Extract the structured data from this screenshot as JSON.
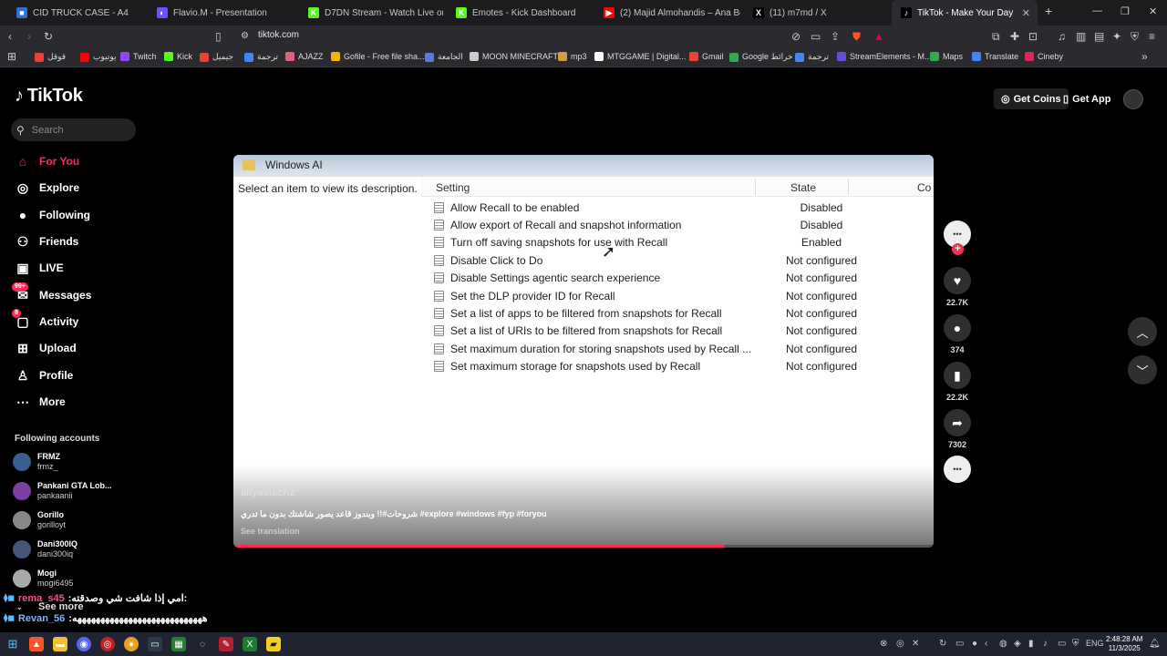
{
  "tabs": [
    {
      "title": "CID TRUCK CASE - A4",
      "color": "#2f6fd6",
      "glyph": "■"
    },
    {
      "title": "Flavio.M - Presentation",
      "color": "#6b52ff",
      "glyph": "◐"
    },
    {
      "title": "D7DN Stream - Watch Live on Kick",
      "color": "#53fc18",
      "glyph": "K"
    },
    {
      "title": "Emotes - Kick Dashboard",
      "color": "#53fc18",
      "glyph": "K"
    },
    {
      "title": "(2) Majid Almohandis – Ana Bel Gow",
      "color": "#ff0000",
      "glyph": "▶"
    },
    {
      "title": "(11) m7md / X",
      "color": "#000000",
      "glyph": "X"
    },
    {
      "title": "TikTok - Make Your Day",
      "color": "#000000",
      "glyph": "♪"
    }
  ],
  "url": "tiktok.com",
  "bookmarks": [
    {
      "label": "قوقل",
      "color": "#ea4335"
    },
    {
      "label": "يوتيوب",
      "color": "#ff0000"
    },
    {
      "label": "Twitch",
      "color": "#9146ff"
    },
    {
      "label": "Kick",
      "color": "#53fc18"
    },
    {
      "label": "جيميل",
      "color": "#ea4335"
    },
    {
      "label": "ترجمة",
      "color": "#4285f4"
    },
    {
      "label": "AJAZZ",
      "color": "#e0607e"
    },
    {
      "label": "Gofile - Free file sha...",
      "color": "#f4b400"
    },
    {
      "label": "الجامعة",
      "color": "#5b7ad6"
    },
    {
      "label": "MOON MINECRAFT",
      "color": "#cccccc"
    },
    {
      "label": "mp3",
      "color": "#d0a040"
    },
    {
      "label": "MTGGAME | Digital...",
      "color": "#ffffff"
    },
    {
      "label": "Gmail",
      "color": "#ea4335"
    },
    {
      "label": "Google خرائط",
      "color": "#34a853"
    },
    {
      "label": "ترجمة",
      "color": "#4285f4"
    },
    {
      "label": "StreamElements - M...",
      "color": "#6a4bd8"
    },
    {
      "label": "Maps",
      "color": "#34a853"
    },
    {
      "label": "Translate",
      "color": "#4285f4"
    },
    {
      "label": "Cineby",
      "color": "#e0245e"
    }
  ],
  "tiktok": {
    "logo": "TikTok",
    "search_placeholder": "Search",
    "nav": [
      {
        "label": "For You",
        "icon": "home-icon",
        "glyph": "⌂"
      },
      {
        "label": "Explore",
        "icon": "compass-icon",
        "glyph": "◎"
      },
      {
        "label": "Following",
        "icon": "following-icon",
        "glyph": "●"
      },
      {
        "label": "Friends",
        "icon": "friends-icon",
        "glyph": "⚇"
      },
      {
        "label": "LIVE",
        "icon": "live-icon",
        "glyph": "▣"
      },
      {
        "label": "Messages",
        "icon": "messages-icon",
        "glyph": "✉",
        "badge": "99+"
      },
      {
        "label": "Activity",
        "icon": "activity-icon",
        "glyph": "▢",
        "badge": "8"
      },
      {
        "label": "Upload",
        "icon": "upload-icon",
        "glyph": "⊞"
      },
      {
        "label": "Profile",
        "icon": "profile-icon",
        "glyph": "♙"
      },
      {
        "label": "More",
        "icon": "more-icon",
        "glyph": "⋯"
      }
    ],
    "following_title": "Following accounts",
    "accounts": [
      {
        "name": "FRMZ",
        "handle": "frmz_",
        "color": "#3a5f8f"
      },
      {
        "name": "Pankani GTA Lob...",
        "handle": "pankaanii",
        "color": "#7a3fa0"
      },
      {
        "name": "Gorillo",
        "handle": "gorilloyt",
        "color": "#888888"
      },
      {
        "name": "Dani300IQ",
        "handle": "dani300iq",
        "color": "#445577"
      },
      {
        "name": "Mogi",
        "handle": "mogi6495",
        "color": "#aaaaaa"
      }
    ],
    "see_more": "See more",
    "get_coins": "Get Coins",
    "get_app": "Get App"
  },
  "chat": [
    {
      "user": "rema_s45",
      "user_color": "#ff4f8b",
      "text": "امي إذا شافت شي وصدقته:"
    },
    {
      "user": "Revan_56",
      "user_color": "#7fb3ff",
      "text": "ههههههههههههههههههههههههههههه"
    }
  ],
  "video": {
    "window_title": "Windows AI",
    "description_hint": "Select an item to view its description.",
    "col_setting": "Setting",
    "col_state": "State",
    "col_comment": "Co",
    "rows": [
      {
        "setting": "Allow Recall to be enabled",
        "state": "Disabled"
      },
      {
        "setting": "Allow export of Recall and snapshot information",
        "state": "Disabled"
      },
      {
        "setting": "Turn off saving snapshots for use with Recall",
        "state": "Enabled"
      },
      {
        "setting": "Disable Click to Do",
        "state": "Not configured"
      },
      {
        "setting": "Disable Settings agentic search experience",
        "state": "Not configured"
      },
      {
        "setting": "Set the DLP provider ID for Recall",
        "state": "Not configured"
      },
      {
        "setting": "Set a list of apps to be filtered from snapshots for Recall",
        "state": "Not configured"
      },
      {
        "setting": "Set a list of URIs to be filtered from snapshots for Recall",
        "state": "Not configured"
      },
      {
        "setting": "Set maximum duration for storing snapshots used by Recall ...",
        "state": "Not configured"
      },
      {
        "setting": "Set maximum storage for snapshots used by Recall",
        "state": "Not configured"
      }
    ],
    "author": "aliyastech2",
    "caption": "شروحات#!! وبندوز قاعد يصور شاشتك بدون ما تدري #explore #windows #fyp #foryou",
    "see_translation": "See translation",
    "progress": 0.7
  },
  "actions": {
    "likes": "22.7K",
    "comments": "374",
    "saves": "22.2K",
    "shares": "7302"
  },
  "clock": {
    "time": "2:48:28 AM",
    "date": "11/3/2025"
  },
  "lang": "ENG"
}
